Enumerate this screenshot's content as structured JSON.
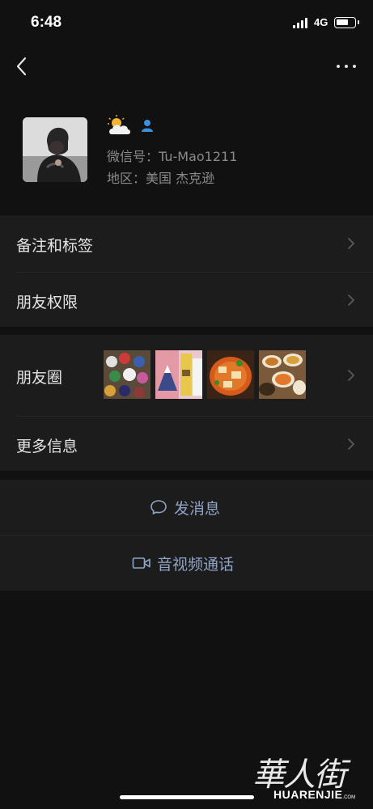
{
  "status_bar": {
    "time": "6:48",
    "network": "4G",
    "battery_level": 0.7
  },
  "nav": {
    "back_icon": "chevron-left-icon",
    "more_icon": "more-dots-icon"
  },
  "profile": {
    "name_icon": "weather-sun-cloud-icon",
    "contact_icon": "contact-person-icon",
    "wechat_id": "微信号：Tu-Mao1211",
    "region": "地区：美国 杰克逊"
  },
  "menu": {
    "remark_tags": "备注和标签",
    "permissions": "朋友权限",
    "moments": "朋友圈",
    "more_info": "更多信息"
  },
  "actions": {
    "send_message": "发消息",
    "video_call": "音视频通话"
  },
  "watermark": {
    "cn": "華人街",
    "en": "HUARENJIE",
    "en_suffix": ".COM"
  },
  "colors": {
    "background": "#111111",
    "card": "#1c1c1c",
    "action_text": "#8fa3c4",
    "secondary_text": "#8a8a8a",
    "contact_icon": "#3d8fdc"
  }
}
